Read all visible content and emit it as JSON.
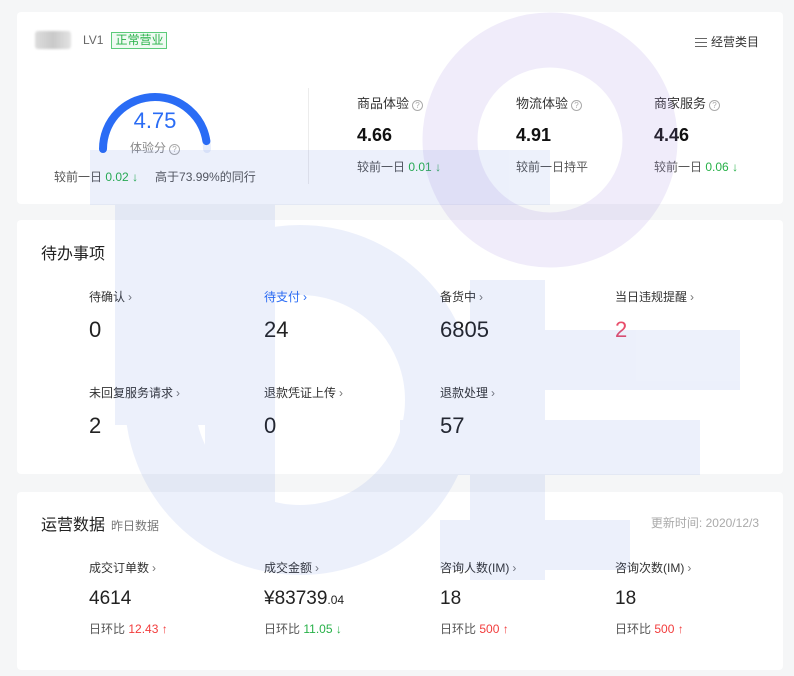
{
  "score_card": {
    "store_level": "LV1",
    "store_status": "正常营业",
    "category_link": "经营类目",
    "score": {
      "value": "4.75",
      "label": "体验分",
      "gauge_fraction": 0.95,
      "compare_prefix": "较前一日",
      "compare_value": "0.02",
      "compare_arrow": "↓",
      "peer_prefix": "高于",
      "peer_value": "73.99%",
      "peer_suffix": "的同行"
    },
    "metrics": [
      {
        "title": "商品体验",
        "value": "4.66",
        "compare_prefix": "较前一日",
        "compare_value": "0.01",
        "compare_arrow": "↓"
      },
      {
        "title": "物流体验",
        "value": "4.91",
        "compare_prefix": "较前一日持平",
        "compare_value": "",
        "compare_arrow": ""
      },
      {
        "title": "商家服务",
        "value": "4.46",
        "compare_prefix": "较前一日",
        "compare_value": "0.06",
        "compare_arrow": "↓"
      }
    ]
  },
  "todo": {
    "title": "待办事项",
    "items": [
      {
        "label": "待确认",
        "value": "0"
      },
      {
        "label": "待支付",
        "value": "24"
      },
      {
        "label": "备货中",
        "value": "6805"
      },
      {
        "label": "当日违规提醒",
        "value": "2"
      },
      {
        "label": "未回复服务请求",
        "value": "2"
      },
      {
        "label": "退款凭证上传",
        "value": "0"
      },
      {
        "label": "退款处理",
        "value": "57"
      }
    ]
  },
  "ops": {
    "title": "运营数据",
    "subtitle": "昨日数据",
    "update_label": "更新时间:",
    "update_date": "2020/12/3",
    "compare_label": "日环比",
    "items": [
      {
        "label": "成交订单数",
        "value": "4614",
        "value_decimals": "",
        "compare_value": "12.43",
        "compare_arrow": "↑"
      },
      {
        "label": "成交金额",
        "value": "¥83739",
        "value_decimals": ".04",
        "compare_value": "11.05",
        "compare_arrow": "↓"
      },
      {
        "label": "咨询人数(IM)",
        "value": "18",
        "value_decimals": "",
        "compare_value": "500",
        "compare_arrow": "↑"
      },
      {
        "label": "咨询次数(IM)",
        "value": "18",
        "value_decimals": "",
        "compare_value": "500",
        "compare_arrow": "↑"
      }
    ]
  },
  "chevron": "›",
  "colors": {
    "accent": "#2a6cf5",
    "down": "#27b148",
    "up": "#f23c3c",
    "alert": "#e84d6a"
  }
}
